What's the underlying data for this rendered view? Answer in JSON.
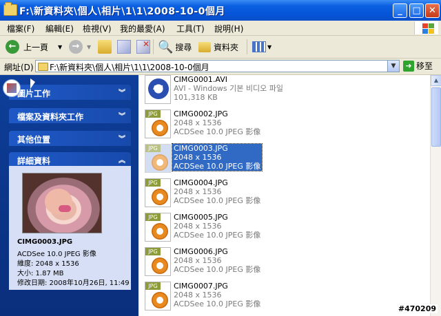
{
  "window": {
    "title": "F:\\新資料夾\\個人\\相片\\1\\1\\2008-10-0個月"
  },
  "menu": [
    "檔案(F)",
    "編輯(E)",
    "檢視(V)",
    "我的最愛(A)",
    "工具(T)",
    "說明(H)"
  ],
  "toolbar": {
    "back_label": "上一頁",
    "search_label": "搜尋",
    "folders_label": "資料夾"
  },
  "address": {
    "label": "網址(D)",
    "path": "F:\\新資料夾\\個人\\相片\\1\\1\\2008-10-0個月",
    "go_label": "移至"
  },
  "taskpane": {
    "sections": [
      "圖片工作",
      "檔案及資料夾工作",
      "其他位置",
      "詳細資料"
    ],
    "details": {
      "filename": "CIMG0003.JPG",
      "type": "ACDSee 10.0 JPEG 影像",
      "dimensions": "維度: 2048 x 1536",
      "size": "大小: 1.87 MB",
      "modified": "修改日期: 2008年10月26日, 11:49"
    }
  },
  "files": [
    {
      "name": "CIMG0001.AVI",
      "line2": "AVI - Windows 기본 비디오 파일",
      "line3": "101,318 KB",
      "kind": "avi"
    },
    {
      "name": "CIMG0002.JPG",
      "line2": "2048 x 1536",
      "line3": "ACDSee 10.0 JPEG 影像",
      "kind": "jpg"
    },
    {
      "name": "CIMG0003.JPG",
      "line2": "2048 x 1536",
      "line3": "ACDSee 10.0 JPEG 影像",
      "kind": "jpg",
      "selected": true
    },
    {
      "name": "CIMG0004.JPG",
      "line2": "2048 x 1536",
      "line3": "ACDSee 10.0 JPEG 影像",
      "kind": "jpg"
    },
    {
      "name": "CIMG0005.JPG",
      "line2": "2048 x 1536",
      "line3": "ACDSee 10.0 JPEG 影像",
      "kind": "jpg"
    },
    {
      "name": "CIMG0006.JPG",
      "line2": "2048 x 1536",
      "line3": "ACDSee 10.0 JPEG 影像",
      "kind": "jpg"
    },
    {
      "name": "CIMG0007.JPG",
      "line2": "2048 x 1536",
      "line3": "ACDSee 10.0 JPEG 影像",
      "kind": "jpg"
    }
  ],
  "watermark": "#470209",
  "colors": {
    "title_blue": "#0654d8",
    "taskpane_blue": "#0b3487",
    "selection": "#316ac5"
  }
}
